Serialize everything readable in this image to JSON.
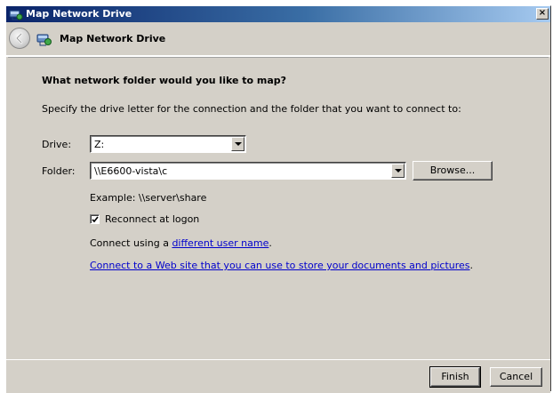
{
  "window": {
    "title": "Map Network Drive",
    "close_glyph": "×"
  },
  "header": {
    "title": "Map Network Drive"
  },
  "content": {
    "main_instruction": "What network folder would you like to map?",
    "sub_instruction": "Specify the drive letter for the connection and the folder that you want to connect to:",
    "drive_label": "Drive:",
    "drive_value": "Z:",
    "folder_label": "Folder:",
    "folder_value": "\\\\E6600-vista\\c",
    "browse_label": "Browse...",
    "example_text": "Example: \\\\server\\share",
    "reconnect_label": "Reconnect at logon",
    "reconnect_checked": true,
    "connect_prefix": "Connect using a ",
    "connect_link": "different user name",
    "connect_suffix": ".",
    "web_link": "Connect to a Web site that you can use to store your documents and pictures",
    "web_suffix": "."
  },
  "footer": {
    "finish_label": "Finish",
    "cancel_label": "Cancel"
  },
  "icons": {
    "title_icon": "network-drive-icon",
    "header_icon": "network-drive-icon",
    "back": "back-arrow-icon",
    "close": "close-icon",
    "dropdown": "chevron-down-icon",
    "check": "checkmark-icon"
  }
}
